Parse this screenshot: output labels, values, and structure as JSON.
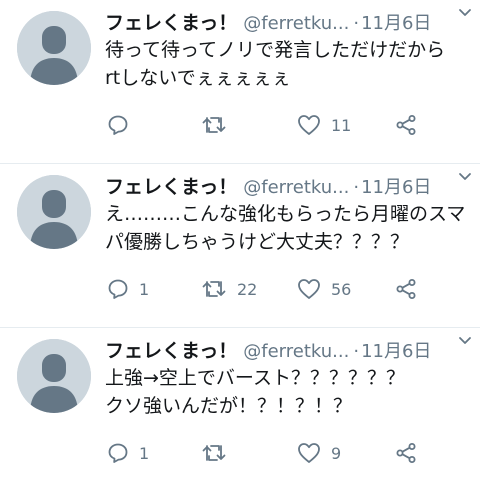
{
  "tweets": [
    {
      "name": "フェレくまっ！",
      "handle": "@ferretku...",
      "separator": "·",
      "time": "11月6日",
      "lines": [
        "待って待ってノリで発言しただけだから",
        "rtしないでぇぇぇぇぇ"
      ],
      "reply_count": "",
      "retweet_count": "",
      "like_count": "11"
    },
    {
      "name": "フェレくまっ！",
      "handle": "@ferretku...",
      "separator": "·",
      "time": "11月6日",
      "lines": [
        "え………こんな強化もらったら月曜のスマ",
        "パ優勝しちゃうけど大丈夫？？？？"
      ],
      "reply_count": "1",
      "retweet_count": "22",
      "like_count": "56"
    },
    {
      "name": "フェレくまっ！",
      "handle": "@ferretku...",
      "separator": "·",
      "time": "11月6日",
      "lines": [
        "上強→空上でバースト？？？？？？",
        "クソ強いんだが！？！？！？"
      ],
      "reply_count": "1",
      "retweet_count": "",
      "like_count": "9"
    }
  ],
  "icons": {
    "avatar": "default-profile-avatar",
    "caret": "chevron-down-icon",
    "reply": "reply-icon",
    "retweet": "retweet-icon",
    "like": "heart-icon",
    "share": "share-icon"
  },
  "colors": {
    "text": "#14171a",
    "secondary": "#657786",
    "avatar_bg": "#ccd6dd",
    "avatar_fg": "#657786",
    "divider": "#e6ecf0"
  }
}
